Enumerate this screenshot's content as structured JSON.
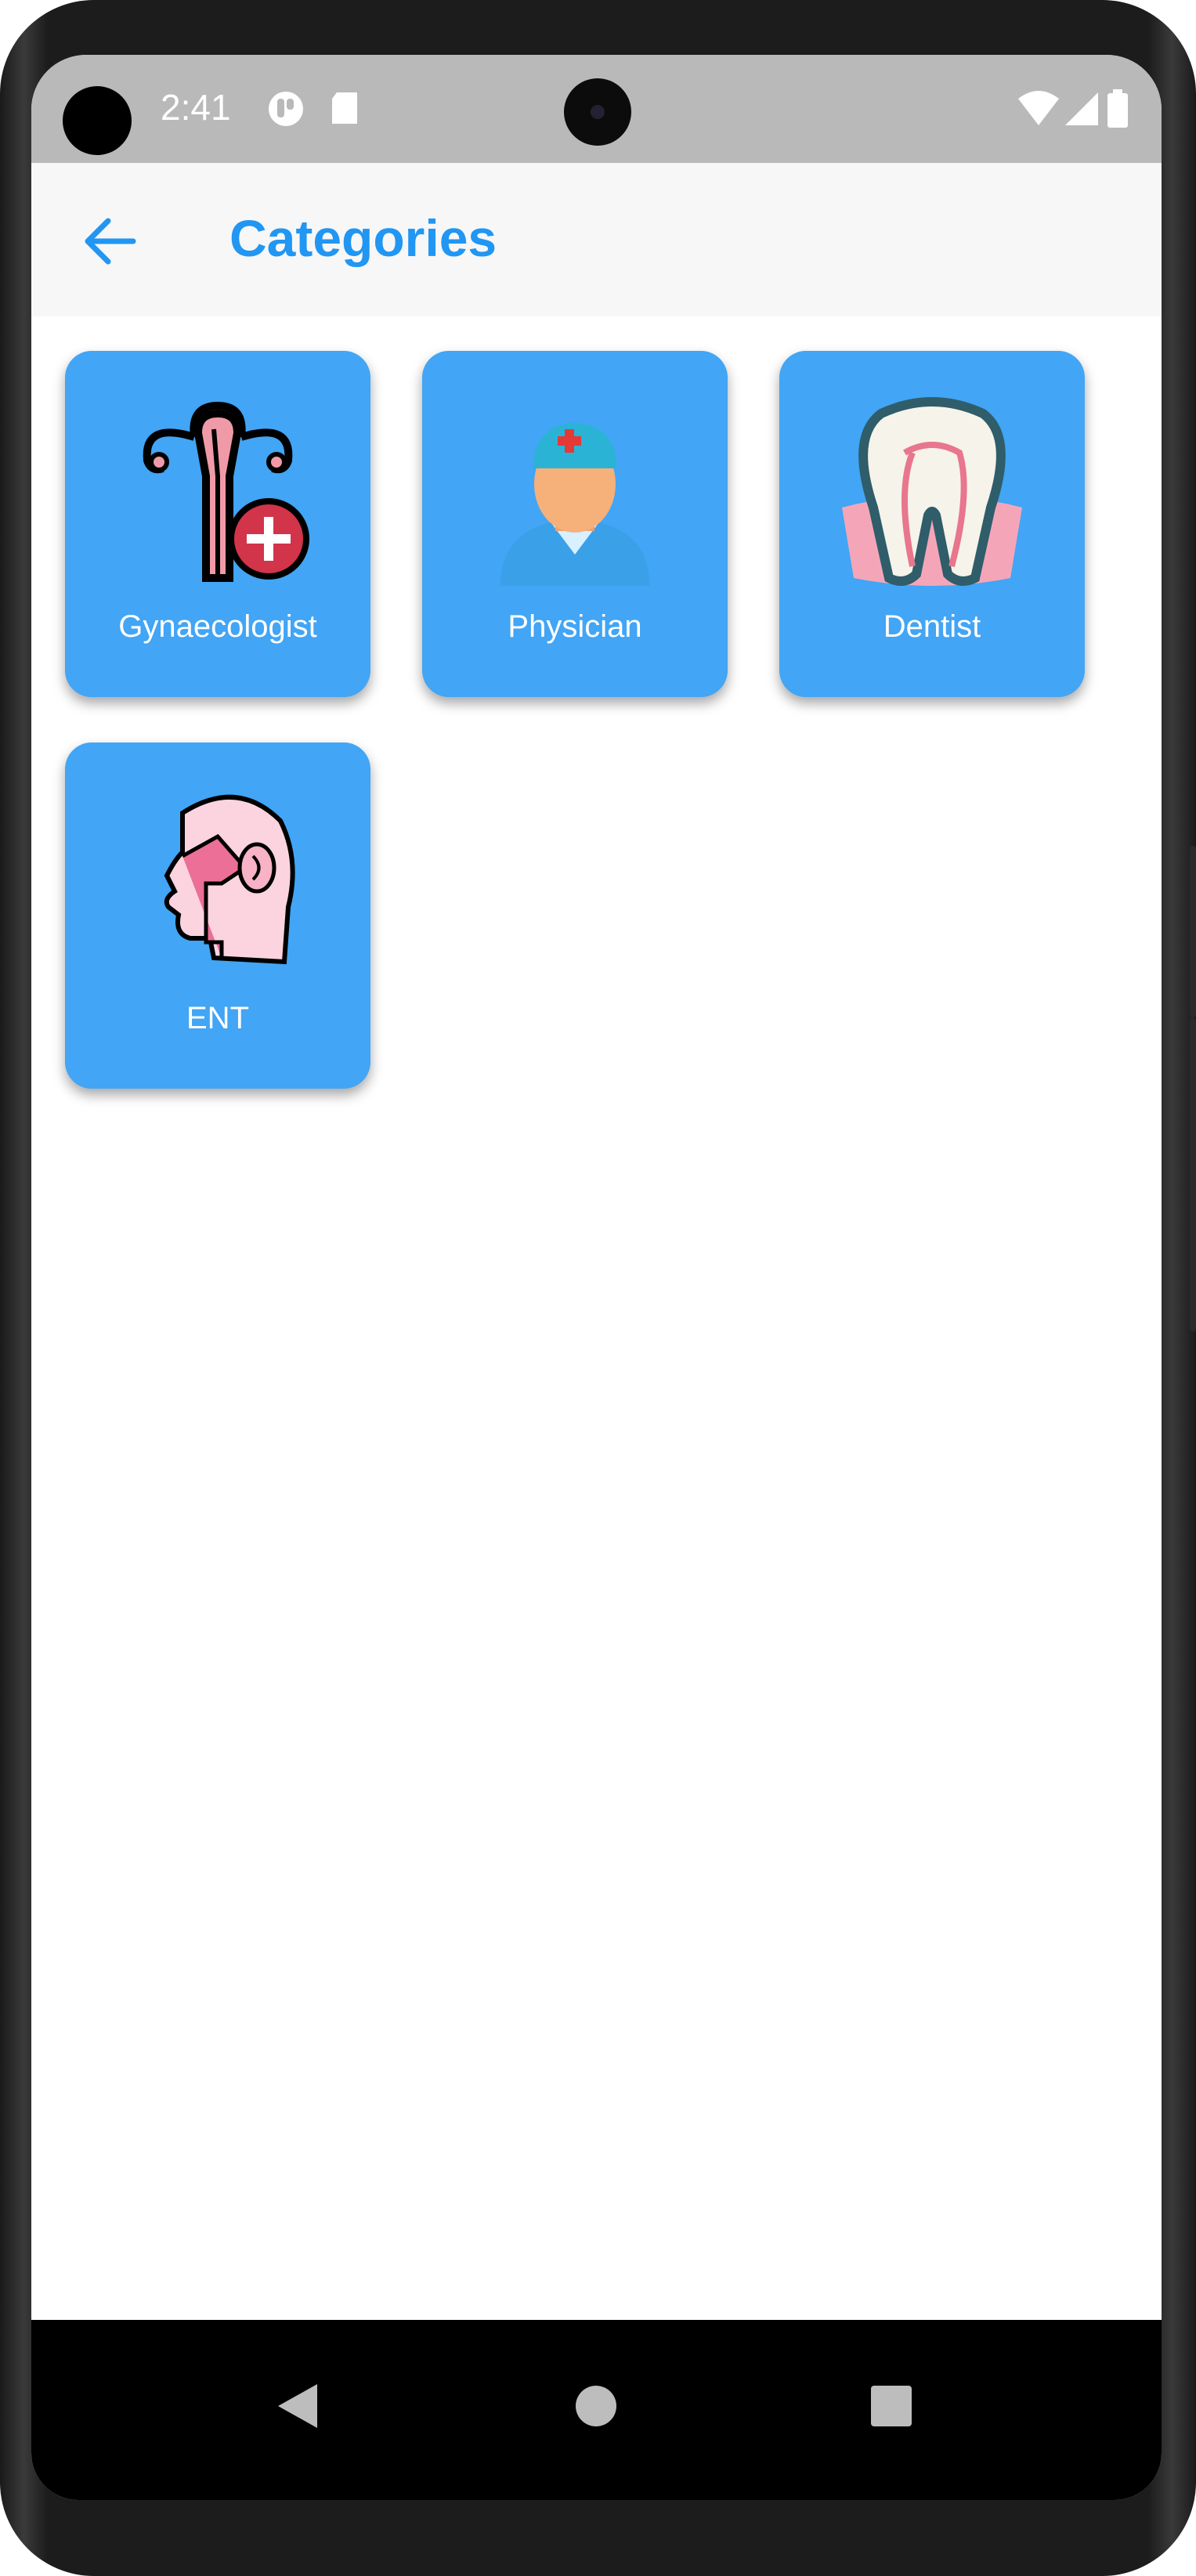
{
  "status_bar": {
    "time": "2:41"
  },
  "app_bar": {
    "title": "Categories"
  },
  "categories": [
    {
      "label": "Gynaecologist",
      "icon": "uterus-plus-icon"
    },
    {
      "label": "Physician",
      "icon": "doctor-icon"
    },
    {
      "label": "Dentist",
      "icon": "tooth-icon"
    },
    {
      "label": "ENT",
      "icon": "head-ent-icon"
    }
  ],
  "colors": {
    "accent": "#2196f3",
    "card": "#42a5f5",
    "statusbar": "#b9b9b9",
    "appbar": "#f7f7f7"
  }
}
